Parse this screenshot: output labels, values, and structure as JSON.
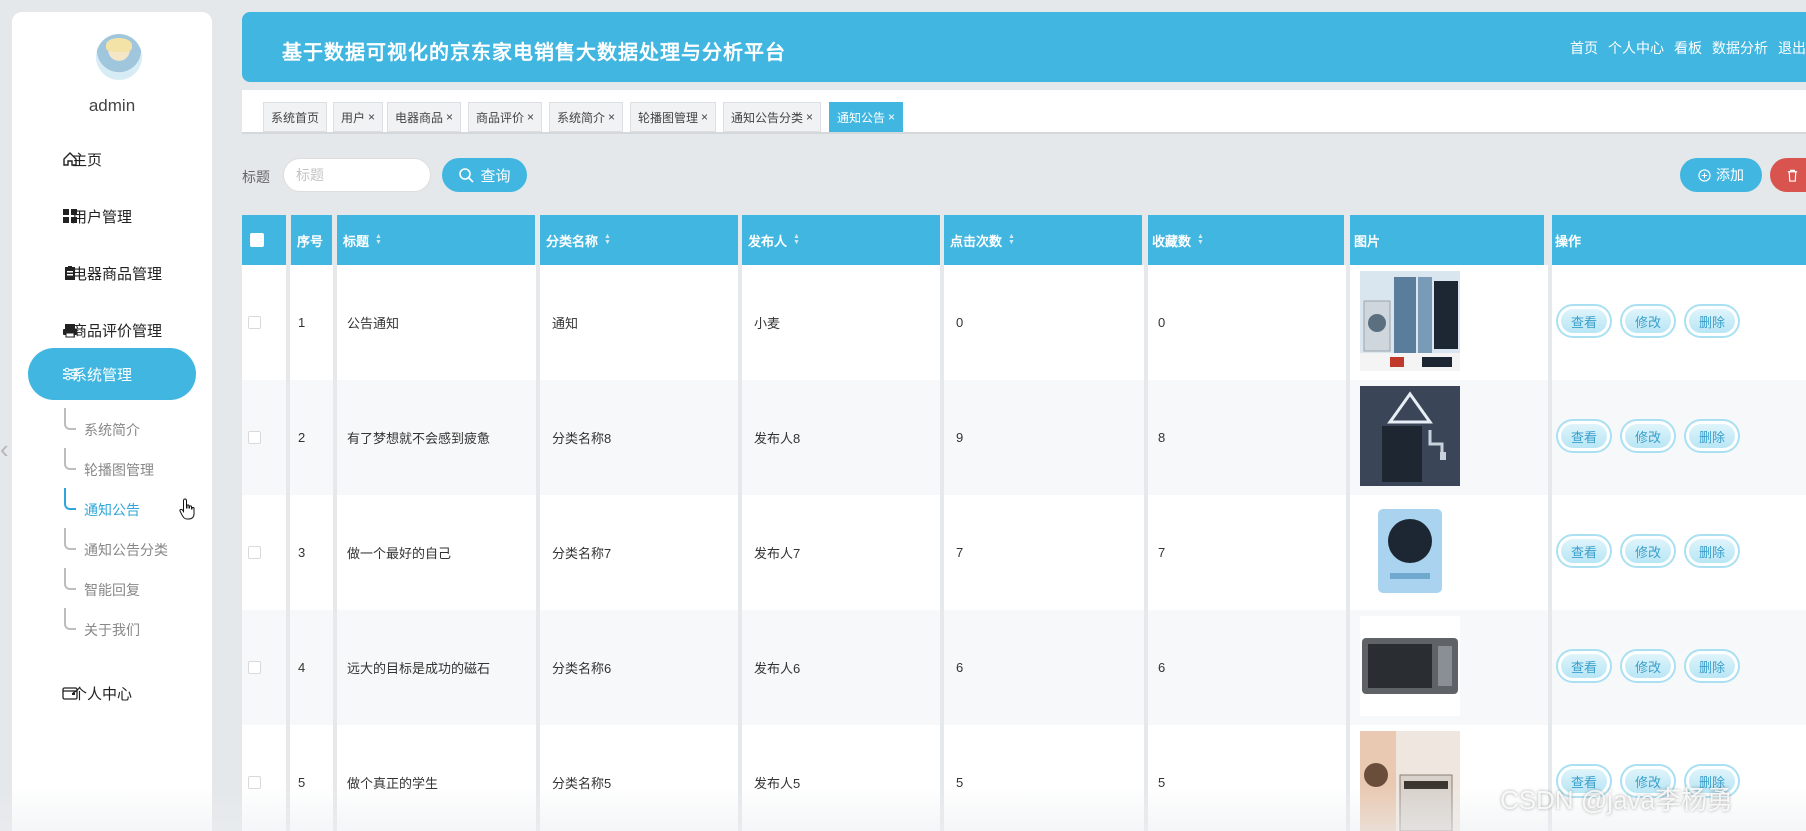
{
  "sidebar": {
    "username": "admin",
    "menu": [
      {
        "label": "主页",
        "icon": "home-icon"
      },
      {
        "label": "用户管理",
        "icon": "grid-icon"
      },
      {
        "label": "电器商品管理",
        "icon": "clipboard-icon"
      },
      {
        "label": "商品评价管理",
        "icon": "printer-icon"
      },
      {
        "label": "系统管理",
        "icon": "sliders-icon"
      },
      {
        "label": "个人中心",
        "icon": "wallet-icon"
      }
    ],
    "submenu": [
      "系统简介",
      "轮播图管理",
      "通知公告",
      "通知公告分类",
      "智能回复",
      "关于我们"
    ],
    "active_submenu": "通知公告"
  },
  "header": {
    "title": "基于数据可视化的京东家电销售大数据处理与分析平台",
    "nav": [
      "首页",
      "个人中心",
      "看板",
      "数据分析",
      "退出"
    ]
  },
  "tabs": [
    "系统首页",
    "用户",
    "电器商品",
    "商品评价",
    "系统简介",
    "轮播图管理",
    "通知公告分类",
    "通知公告"
  ],
  "active_tab": "通知公告",
  "search": {
    "label": "标题",
    "placeholder": "标题",
    "query_label": "查询",
    "add_label": "添加"
  },
  "table": {
    "columns": [
      "序号",
      "标题",
      "分类名称",
      "发布人",
      "点击次数",
      "收藏数",
      "图片",
      "操作"
    ],
    "rows": [
      {
        "index": "1",
        "title": "公告通知",
        "category": "通知",
        "publisher": "小麦",
        "clicks": "0",
        "favorites": "0",
        "image": "appliances-photo"
      },
      {
        "index": "2",
        "title": "有了梦想就不会感到疲惫",
        "category": "分类名称8",
        "publisher": "发布人8",
        "clicks": "9",
        "favorites": "8",
        "image": "water-purifier-photo"
      },
      {
        "index": "3",
        "title": "做一个最好的自己",
        "category": "分类名称7",
        "publisher": "发布人7",
        "clicks": "7",
        "favorites": "7",
        "image": "induction-cooker-photo"
      },
      {
        "index": "4",
        "title": "远大的目标是成功的磁石",
        "category": "分类名称6",
        "publisher": "发布人6",
        "clicks": "6",
        "favorites": "6",
        "image": "microwave-photo"
      },
      {
        "index": "5",
        "title": "做个真正的学生",
        "category": "分类名称5",
        "publisher": "发布人5",
        "clicks": "5",
        "favorites": "5",
        "image": "dishwasher-photo"
      }
    ],
    "actions": [
      "查看",
      "修改",
      "删除"
    ]
  },
  "watermark": "CSDN @java李杨勇",
  "colors": {
    "accent": "#41b6e0",
    "danger": "#d9534f",
    "background": "#e4e8ea"
  }
}
